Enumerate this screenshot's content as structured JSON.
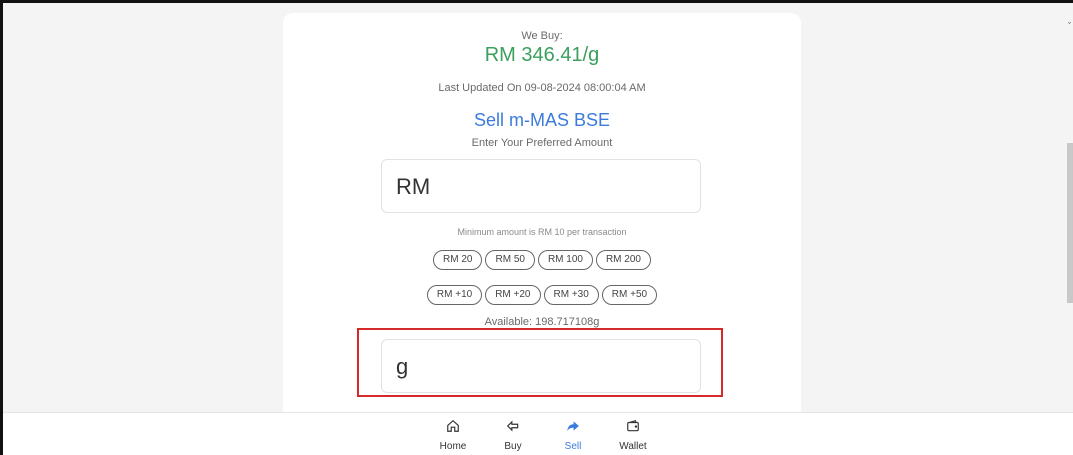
{
  "rate": {
    "label": "We Buy:",
    "price": "RM 346.41/g",
    "updated": "Last Updated On 09-08-2024 08:00:04 AM"
  },
  "sell": {
    "title": "Sell m-MAS BSE",
    "prompt": "Enter Your Preferred Amount",
    "amount_prefix": "RM",
    "minimum": "Minimum amount is RM 10 per transaction",
    "quick_amounts": [
      "RM 20",
      "RM 50",
      "RM 100",
      "RM 200"
    ],
    "increments": [
      "RM +10",
      "RM +20",
      "RM +30",
      "RM +50"
    ],
    "available": "Available: 198.717108g",
    "grams_prefix": "g"
  },
  "nav": {
    "items": [
      {
        "label": "Home",
        "icon": "home-icon"
      },
      {
        "label": "Buy",
        "icon": "buy-icon"
      },
      {
        "label": "Sell",
        "icon": "sell-icon"
      },
      {
        "label": "Wallet",
        "icon": "wallet-icon"
      }
    ],
    "active": "Sell"
  },
  "colors": {
    "price": "#3aa05c",
    "accent": "#3b7bdc",
    "highlight_border": "#d42a2a"
  }
}
